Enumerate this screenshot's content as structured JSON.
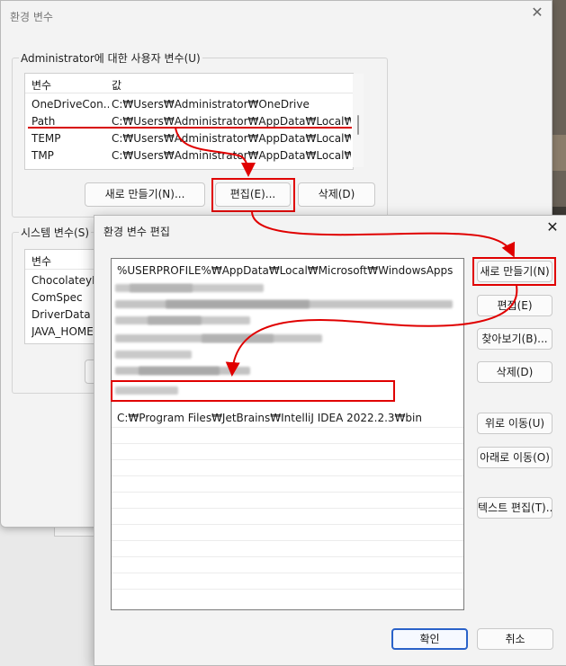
{
  "outer": {
    "title": "환경 변수",
    "user_group_label": "Administrator에 대한 사용자 변수(U)",
    "user_vars": {
      "headers": [
        "변수",
        "값"
      ],
      "rows": [
        {
          "name": "OneDriveCon...",
          "value": "C:₩Users₩Administrator₩OneDrive"
        },
        {
          "name": "Path",
          "value": "C:₩Users₩Administrator₩AppData₩Local₩Mic..."
        },
        {
          "name": "TEMP",
          "value": "C:₩Users₩Administrator₩AppData₩Local₩Te..."
        },
        {
          "name": "TMP",
          "value": "C:₩Users₩Administrator₩AppData₩Local₩Te..."
        }
      ]
    },
    "buttons": {
      "new": "새로 만들기(N)...",
      "edit": "편집(E)...",
      "delete": "삭제(D)"
    },
    "system_group_label": "시스템 변수(S)",
    "system_vars": {
      "headers": [
        "변수"
      ],
      "rows": [
        "ChocolateyIn",
        "ComSpec",
        "DriverData",
        "JAVA_HOME"
      ]
    }
  },
  "inner": {
    "title": "환경 변수 편집",
    "paths": [
      "%USERPROFILE%₩AppData₩Local₩Microsoft₩WindowsApps",
      "C:₩Program Files₩JetBrains₩IntelliJ IDEA 2022.2.3₩bin"
    ],
    "buttons": {
      "new": "새로 만들기(N)",
      "edit": "편집(E)",
      "browse": "찾아보기(B)...",
      "delete": "삭제(D)",
      "move_up": "위로 이동(U)",
      "move_down": "아래로 이동(O)",
      "edit_text": "텍스트 편집(T)...",
      "ok": "확인",
      "cancel": "취소"
    }
  },
  "colors": {
    "annotation": "#e00000",
    "primary_border": "#2a62c9"
  }
}
